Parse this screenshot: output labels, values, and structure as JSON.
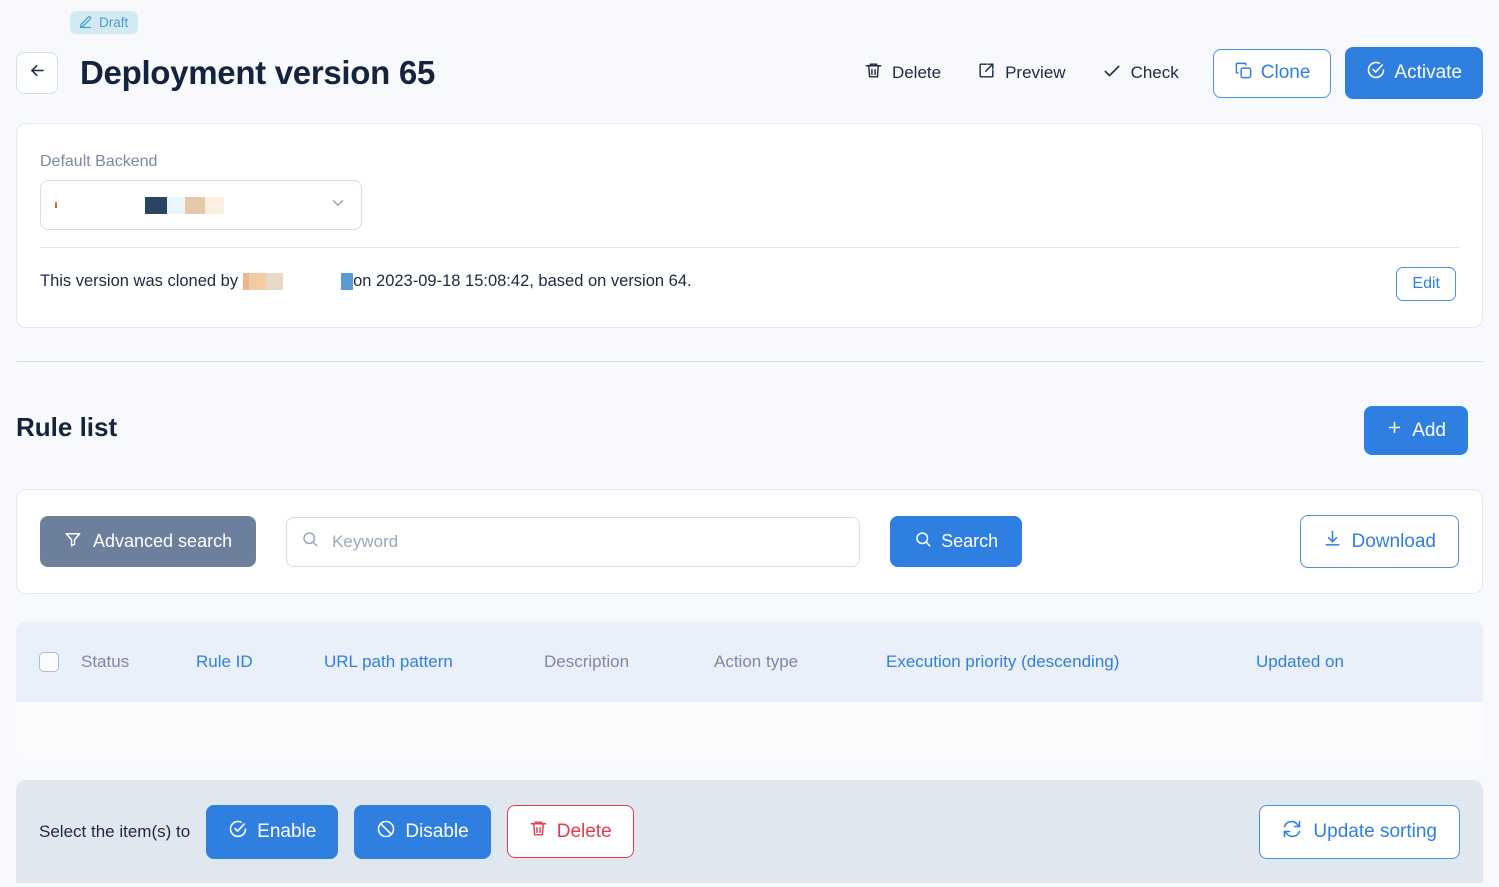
{
  "header": {
    "status_badge": {
      "label": "Draft",
      "icon": "pencil-icon",
      "bg": "#d3eaf5",
      "fg": "#4b9fc4"
    },
    "back_icon": "arrow-left-icon",
    "title": "Deployment version 65",
    "actions": {
      "delete": {
        "label": "Delete",
        "icon": "trash-icon"
      },
      "preview": {
        "label": "Preview",
        "icon": "external-link-icon"
      },
      "check": {
        "label": "Check",
        "icon": "checkmark-icon"
      },
      "clone": {
        "label": "Clone",
        "icon": "copy-icon"
      },
      "activate": {
        "label": "Activate",
        "icon": "check-circle-icon"
      }
    }
  },
  "backend_card": {
    "field_label": "Default Backend",
    "select_value": "",
    "select_icon": "chevron-down-icon",
    "redactions": [
      "#2c4463",
      "#eaf6fb",
      "#e3c9a8",
      "#fceee0"
    ],
    "note_prefix": "This version was cloned by",
    "note_suffix": "on 2023-09-18 15:08:42, based on version 64.",
    "note_redactions": [
      "#f5cba4",
      "#e8d9c6",
      "#5b9bd5"
    ],
    "edit_label": "Edit"
  },
  "rule_list": {
    "title": "Rule list",
    "add_label": "Add",
    "add_icon": "plus-icon",
    "search": {
      "advanced_label": "Advanced search",
      "advanced_icon": "filter-icon",
      "keyword_placeholder": "Keyword",
      "keyword_value": "",
      "keyword_icon": "search-icon",
      "search_label": "Search",
      "search_icon": "search-icon",
      "download_label": "Download",
      "download_icon": "download-icon"
    },
    "columns": [
      {
        "label": "Status",
        "sortable": false
      },
      {
        "label": "Rule ID",
        "sortable": true
      },
      {
        "label": "URL path pattern",
        "sortable": true
      },
      {
        "label": "Description",
        "sortable": false
      },
      {
        "label": "Action type",
        "sortable": false
      },
      {
        "label": "Execution priority (descending)",
        "sortable": true
      },
      {
        "label": "Updated on",
        "sortable": true
      }
    ],
    "rows": []
  },
  "bottom_bar": {
    "label": "Select the item(s) to",
    "enable_label": "Enable",
    "enable_icon": "check-circle-icon",
    "disable_label": "Disable",
    "disable_icon": "ban-icon",
    "delete_label": "Delete",
    "delete_icon": "trash-icon",
    "update_sorting_label": "Update sorting",
    "update_sorting_icon": "refresh-icon"
  },
  "colors": {
    "accent": "#2f7fe0",
    "danger": "#e8384f",
    "slate": "#6c7f9c",
    "page_bg": "#f7f9fc"
  }
}
